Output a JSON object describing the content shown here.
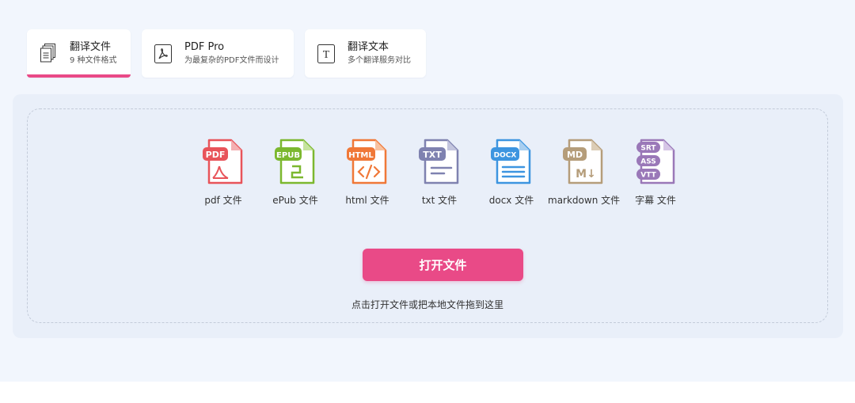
{
  "tabs": [
    {
      "title": "翻译文件",
      "subtitle": "9 种文件格式",
      "icon": "documents-icon",
      "active": true
    },
    {
      "title": "PDF Pro",
      "subtitle": "为最复杂的PDF文件而设计",
      "icon": "pdf-icon",
      "active": false
    },
    {
      "title": "翻译文本",
      "subtitle": "多个翻译服务对比",
      "icon": "text-icon",
      "active": false
    }
  ],
  "file_types": [
    {
      "badge": "PDF",
      "label": "pdf 文件",
      "color": "#e8545a"
    },
    {
      "badge": "EPUB",
      "label": "ePub 文件",
      "color": "#7cb82f"
    },
    {
      "badge": "HTML",
      "label": "html 文件",
      "color": "#f07838"
    },
    {
      "badge": "TXT",
      "label": "txt 文件",
      "color": "#7f82b0"
    },
    {
      "badge": "DOCX",
      "label": "docx 文件",
      "color": "#3d95e0"
    },
    {
      "badge": "MD",
      "badge_body": "M↓",
      "label": "markdown 文件",
      "color": "#b59d7a"
    },
    {
      "badges": [
        "SRT",
        "ASS",
        "VTT"
      ],
      "label": "字幕 文件",
      "color": "#9a78b8"
    }
  ],
  "open_button": "打开文件",
  "hint": "点击打开文件或把本地文件拖到这里",
  "colors": {
    "accent": "#e94a87",
    "background": "#f2f6fd",
    "dropzone": "#e9eff9"
  }
}
